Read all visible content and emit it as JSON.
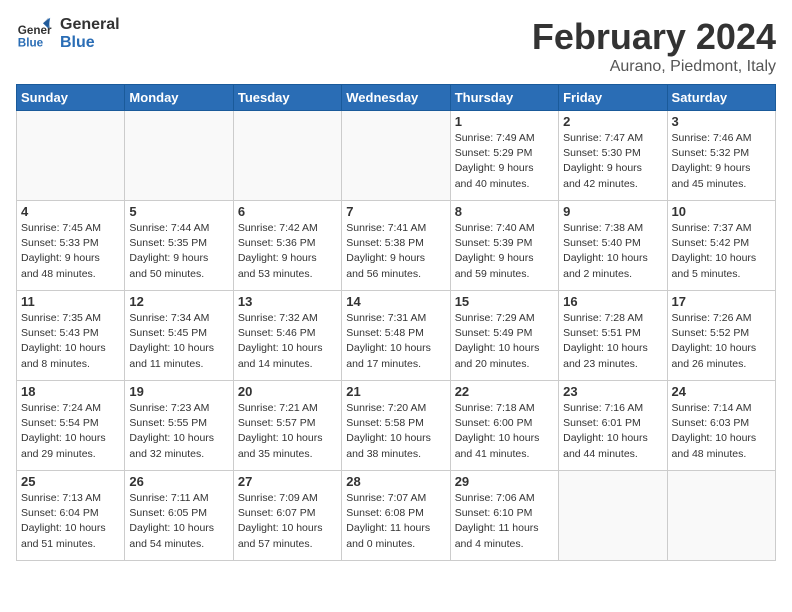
{
  "logo": {
    "line1": "General",
    "line2": "Blue"
  },
  "title": "February 2024",
  "subtitle": "Aurano, Piedmont, Italy",
  "weekdays": [
    "Sunday",
    "Monday",
    "Tuesday",
    "Wednesday",
    "Thursday",
    "Friday",
    "Saturday"
  ],
  "weeks": [
    [
      {
        "day": "",
        "info": ""
      },
      {
        "day": "",
        "info": ""
      },
      {
        "day": "",
        "info": ""
      },
      {
        "day": "",
        "info": ""
      },
      {
        "day": "1",
        "info": "Sunrise: 7:49 AM\nSunset: 5:29 PM\nDaylight: 9 hours\nand 40 minutes."
      },
      {
        "day": "2",
        "info": "Sunrise: 7:47 AM\nSunset: 5:30 PM\nDaylight: 9 hours\nand 42 minutes."
      },
      {
        "day": "3",
        "info": "Sunrise: 7:46 AM\nSunset: 5:32 PM\nDaylight: 9 hours\nand 45 minutes."
      }
    ],
    [
      {
        "day": "4",
        "info": "Sunrise: 7:45 AM\nSunset: 5:33 PM\nDaylight: 9 hours\nand 48 minutes."
      },
      {
        "day": "5",
        "info": "Sunrise: 7:44 AM\nSunset: 5:35 PM\nDaylight: 9 hours\nand 50 minutes."
      },
      {
        "day": "6",
        "info": "Sunrise: 7:42 AM\nSunset: 5:36 PM\nDaylight: 9 hours\nand 53 minutes."
      },
      {
        "day": "7",
        "info": "Sunrise: 7:41 AM\nSunset: 5:38 PM\nDaylight: 9 hours\nand 56 minutes."
      },
      {
        "day": "8",
        "info": "Sunrise: 7:40 AM\nSunset: 5:39 PM\nDaylight: 9 hours\nand 59 minutes."
      },
      {
        "day": "9",
        "info": "Sunrise: 7:38 AM\nSunset: 5:40 PM\nDaylight: 10 hours\nand 2 minutes."
      },
      {
        "day": "10",
        "info": "Sunrise: 7:37 AM\nSunset: 5:42 PM\nDaylight: 10 hours\nand 5 minutes."
      }
    ],
    [
      {
        "day": "11",
        "info": "Sunrise: 7:35 AM\nSunset: 5:43 PM\nDaylight: 10 hours\nand 8 minutes."
      },
      {
        "day": "12",
        "info": "Sunrise: 7:34 AM\nSunset: 5:45 PM\nDaylight: 10 hours\nand 11 minutes."
      },
      {
        "day": "13",
        "info": "Sunrise: 7:32 AM\nSunset: 5:46 PM\nDaylight: 10 hours\nand 14 minutes."
      },
      {
        "day": "14",
        "info": "Sunrise: 7:31 AM\nSunset: 5:48 PM\nDaylight: 10 hours\nand 17 minutes."
      },
      {
        "day": "15",
        "info": "Sunrise: 7:29 AM\nSunset: 5:49 PM\nDaylight: 10 hours\nand 20 minutes."
      },
      {
        "day": "16",
        "info": "Sunrise: 7:28 AM\nSunset: 5:51 PM\nDaylight: 10 hours\nand 23 minutes."
      },
      {
        "day": "17",
        "info": "Sunrise: 7:26 AM\nSunset: 5:52 PM\nDaylight: 10 hours\nand 26 minutes."
      }
    ],
    [
      {
        "day": "18",
        "info": "Sunrise: 7:24 AM\nSunset: 5:54 PM\nDaylight: 10 hours\nand 29 minutes."
      },
      {
        "day": "19",
        "info": "Sunrise: 7:23 AM\nSunset: 5:55 PM\nDaylight: 10 hours\nand 32 minutes."
      },
      {
        "day": "20",
        "info": "Sunrise: 7:21 AM\nSunset: 5:57 PM\nDaylight: 10 hours\nand 35 minutes."
      },
      {
        "day": "21",
        "info": "Sunrise: 7:20 AM\nSunset: 5:58 PM\nDaylight: 10 hours\nand 38 minutes."
      },
      {
        "day": "22",
        "info": "Sunrise: 7:18 AM\nSunset: 6:00 PM\nDaylight: 10 hours\nand 41 minutes."
      },
      {
        "day": "23",
        "info": "Sunrise: 7:16 AM\nSunset: 6:01 PM\nDaylight: 10 hours\nand 44 minutes."
      },
      {
        "day": "24",
        "info": "Sunrise: 7:14 AM\nSunset: 6:03 PM\nDaylight: 10 hours\nand 48 minutes."
      }
    ],
    [
      {
        "day": "25",
        "info": "Sunrise: 7:13 AM\nSunset: 6:04 PM\nDaylight: 10 hours\nand 51 minutes."
      },
      {
        "day": "26",
        "info": "Sunrise: 7:11 AM\nSunset: 6:05 PM\nDaylight: 10 hours\nand 54 minutes."
      },
      {
        "day": "27",
        "info": "Sunrise: 7:09 AM\nSunset: 6:07 PM\nDaylight: 10 hours\nand 57 minutes."
      },
      {
        "day": "28",
        "info": "Sunrise: 7:07 AM\nSunset: 6:08 PM\nDaylight: 11 hours\nand 0 minutes."
      },
      {
        "day": "29",
        "info": "Sunrise: 7:06 AM\nSunset: 6:10 PM\nDaylight: 11 hours\nand 4 minutes."
      },
      {
        "day": "",
        "info": ""
      },
      {
        "day": "",
        "info": ""
      }
    ]
  ]
}
